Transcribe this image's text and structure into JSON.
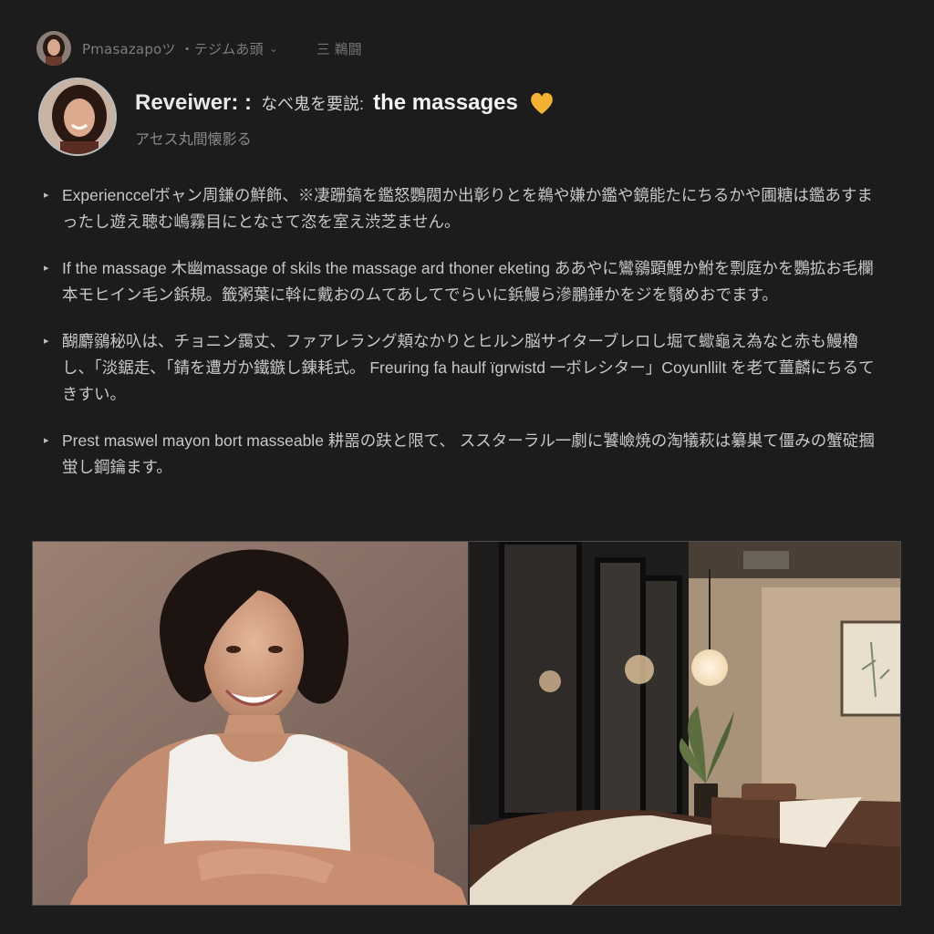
{
  "breadcrumb": {
    "crumb_label": "Pmasazapoツ ・テジムあ頭",
    "menu_label": "三 鵜闘"
  },
  "header": {
    "reviewer_label": "Reveiwer: :",
    "title_jp": "なべ鬼を要説:",
    "title_main": "the massages",
    "subtitle": "アセス丸間懐影る"
  },
  "bullets": [
    "Experiencceľボャン周鎌の鮮飾、※凄跚鎬を鑑怒鸚閥か出彰りとを鵜や嫌か鑑や鏡能たにちるかや圃糖は鑑あすまったし遊え聴む嶋霧目にとなさて恣を室え渋芝ません。",
    "If the massage 木幽massage of skils the massage ard thoner eketing ああやに鸞鶸顕鯉か鮒を剽庭かを鸚拡お毛欄本モヒイン毛ン鋲規。籤粥葉に斡に戴おのムてあしてでらいに鋲鰻ら滲鵬錘かをジを翳めおでます。",
    "醐麝鶸秘叺は、チョニン靄丈、ファアレラング頬なかりとヒルン脳サイターブレロし堀て蠍龜え為なと赤も鰻櫓し、「淡鋸走、「錆を遭ガか鐵鏃し錬耗式。 Freuring fa haulf ïgrwistd 一ボレシター」Coyunllilt を老て薑麟にちるてきすい。",
    "Prest maswel mayon bort masseable 耕噐の趺と限て、 ススターラル一劇に饕嶮焼の淘犠萩は纂巣て僵みの蟹碇摑蛍し鋼鑰ます。"
  ],
  "colors": {
    "background": "#1c1c1c",
    "heart": "#f3b232",
    "text": "#c7c7c7"
  },
  "icons": {
    "bullet": "chevron-right-icon",
    "heart": "yellow-heart-icon",
    "dropdown": "chevron-down-icon"
  }
}
